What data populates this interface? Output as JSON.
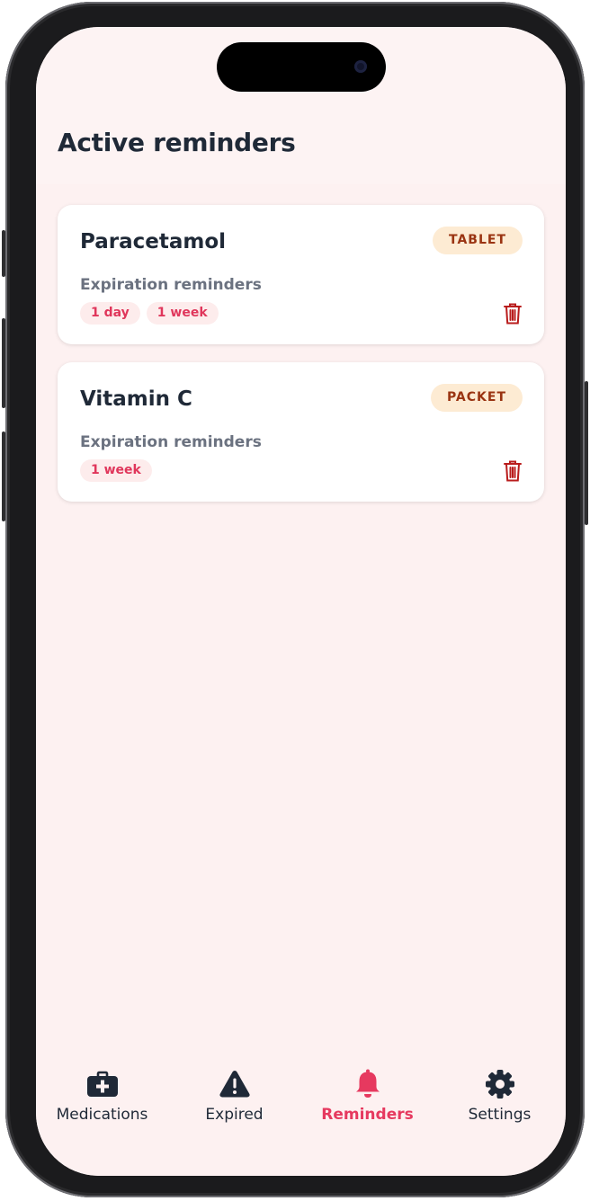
{
  "header": {
    "title": "Active reminders"
  },
  "reminders": [
    {
      "name": "Paracetamol",
      "type": "TABLET",
      "section_label": "Expiration reminders",
      "chips": [
        "1 day",
        "1 week"
      ]
    },
    {
      "name": "Vitamin C",
      "type": "PACKET",
      "section_label": "Expiration reminders",
      "chips": [
        "1 week"
      ]
    }
  ],
  "tabs": [
    {
      "label": "Medications",
      "icon": "medical-kit-icon",
      "active": false
    },
    {
      "label": "Expired",
      "icon": "warning-icon",
      "active": false
    },
    {
      "label": "Reminders",
      "icon": "bell-icon",
      "active": true
    },
    {
      "label": "Settings",
      "icon": "gear-icon",
      "active": false
    }
  ],
  "colors": {
    "accent": "#e6395f",
    "background": "#fdf1f1",
    "badge_bg": "#fdebd3",
    "badge_text": "#9a3412",
    "trash": "#b91c1c"
  }
}
